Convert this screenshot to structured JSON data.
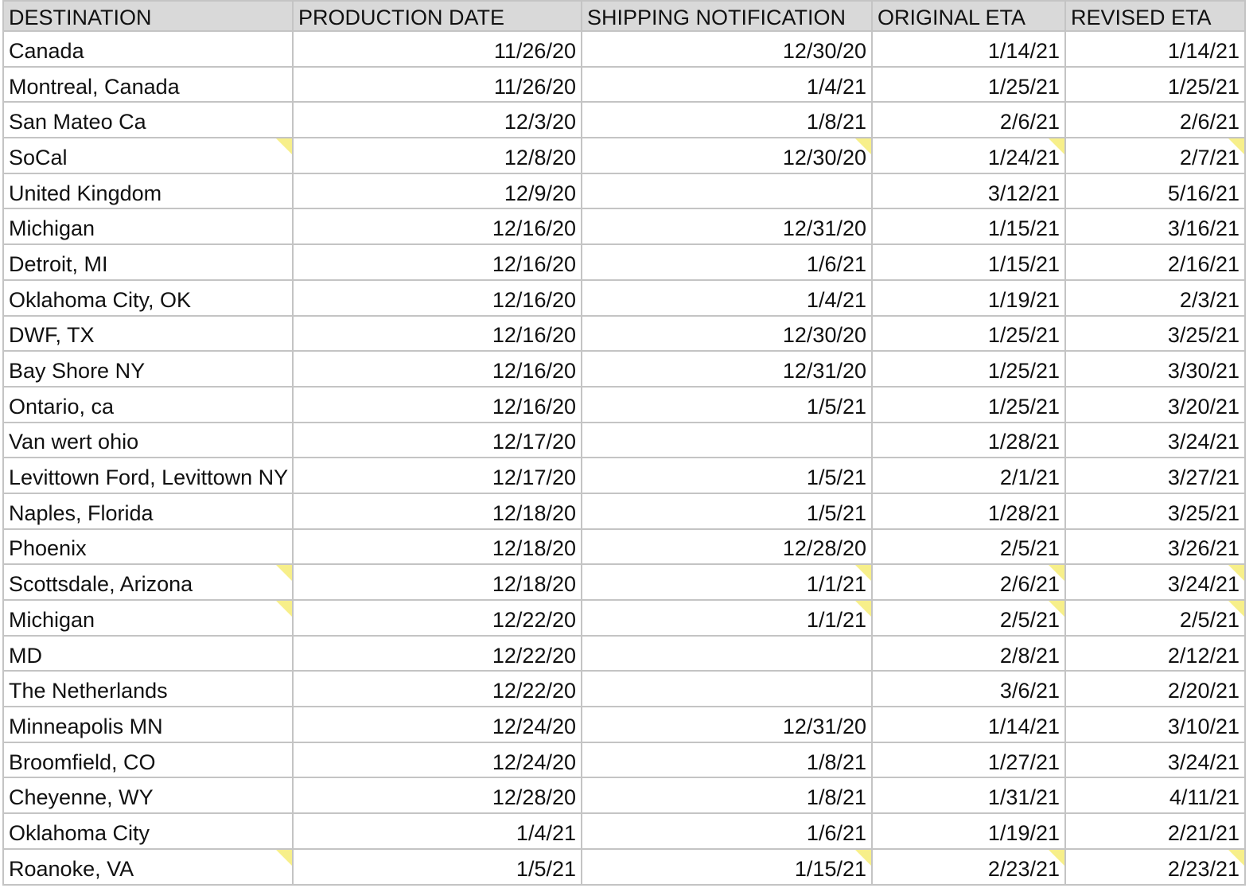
{
  "sheet": {
    "columns": [
      "DESTINATION",
      "PRODUCTION DATE",
      "SHIPPING NOTIFICATION",
      "ORIGINAL ETA",
      "REVISED ETA"
    ],
    "note_color": "#f7ef8a",
    "rows": [
      {
        "cells": [
          "Canada",
          "11/26/20",
          "12/30/20",
          "1/14/21",
          "1/14/21"
        ],
        "notes": [
          false,
          false,
          false,
          false,
          false
        ]
      },
      {
        "cells": [
          "Montreal, Canada",
          "11/26/20",
          "1/4/21",
          "1/25/21",
          "1/25/21"
        ],
        "notes": [
          false,
          false,
          false,
          false,
          false
        ]
      },
      {
        "cells": [
          "San Mateo Ca",
          "12/3/20",
          "1/8/21",
          "2/6/21",
          "2/6/21"
        ],
        "notes": [
          false,
          false,
          false,
          false,
          false
        ]
      },
      {
        "cells": [
          "SoCal",
          "12/8/20",
          "12/30/20",
          "1/24/21",
          "2/7/21"
        ],
        "notes": [
          true,
          false,
          true,
          true,
          true
        ]
      },
      {
        "cells": [
          "United Kingdom",
          "12/9/20",
          "",
          "3/12/21",
          "5/16/21"
        ],
        "notes": [
          false,
          false,
          false,
          false,
          false
        ]
      },
      {
        "cells": [
          "Michigan",
          "12/16/20",
          "12/31/20",
          "1/15/21",
          "3/16/21"
        ],
        "notes": [
          false,
          false,
          false,
          false,
          false
        ]
      },
      {
        "cells": [
          "Detroit, MI",
          "12/16/20",
          "1/6/21",
          "1/15/21",
          "2/16/21"
        ],
        "notes": [
          false,
          false,
          false,
          false,
          false
        ]
      },
      {
        "cells": [
          "Oklahoma City, OK",
          "12/16/20",
          "1/4/21",
          "1/19/21",
          "2/3/21"
        ],
        "notes": [
          false,
          false,
          false,
          false,
          false
        ]
      },
      {
        "cells": [
          "DWF, TX",
          "12/16/20",
          "12/30/20",
          "1/25/21",
          "3/25/21"
        ],
        "notes": [
          false,
          false,
          false,
          false,
          false
        ]
      },
      {
        "cells": [
          "Bay Shore NY",
          "12/16/20",
          "12/31/20",
          "1/25/21",
          "3/30/21"
        ],
        "notes": [
          false,
          false,
          false,
          false,
          false
        ]
      },
      {
        "cells": [
          "Ontario, ca",
          "12/16/20",
          "1/5/21",
          "1/25/21",
          "3/20/21"
        ],
        "notes": [
          false,
          false,
          false,
          false,
          false
        ]
      },
      {
        "cells": [
          "Van wert ohio",
          "12/17/20",
          "",
          "1/28/21",
          "3/24/21"
        ],
        "notes": [
          false,
          false,
          false,
          false,
          false
        ]
      },
      {
        "cells": [
          "Levittown Ford, Levittown NY",
          "12/17/20",
          "1/5/21",
          "2/1/21",
          "3/27/21"
        ],
        "notes": [
          false,
          false,
          false,
          false,
          false
        ]
      },
      {
        "cells": [
          "Naples, Florida",
          "12/18/20",
          "1/5/21",
          "1/28/21",
          "3/25/21"
        ],
        "notes": [
          false,
          false,
          false,
          false,
          false
        ]
      },
      {
        "cells": [
          "Phoenix",
          "12/18/20",
          "12/28/20",
          "2/5/21",
          "3/26/21"
        ],
        "notes": [
          false,
          false,
          false,
          false,
          false
        ]
      },
      {
        "cells": [
          "Scottsdale, Arizona",
          "12/18/20",
          "1/1/21",
          "2/6/21",
          "3/24/21"
        ],
        "notes": [
          true,
          false,
          true,
          true,
          true
        ]
      },
      {
        "cells": [
          "Michigan",
          "12/22/20",
          "1/1/21",
          "2/5/21",
          "2/5/21"
        ],
        "notes": [
          true,
          false,
          true,
          true,
          true
        ]
      },
      {
        "cells": [
          "MD",
          "12/22/20",
          "",
          "2/8/21",
          "2/12/21"
        ],
        "notes": [
          false,
          false,
          false,
          false,
          false
        ]
      },
      {
        "cells": [
          "The Netherlands",
          "12/22/20",
          "",
          "3/6/21",
          "2/20/21"
        ],
        "notes": [
          false,
          false,
          false,
          false,
          false
        ]
      },
      {
        "cells": [
          "Minneapolis MN",
          "12/24/20",
          "12/31/20",
          "1/14/21",
          "3/10/21"
        ],
        "notes": [
          false,
          false,
          false,
          false,
          false
        ]
      },
      {
        "cells": [
          "Broomfield, CO",
          "12/24/20",
          "1/8/21",
          "1/27/21",
          "3/24/21"
        ],
        "notes": [
          false,
          false,
          false,
          false,
          false
        ]
      },
      {
        "cells": [
          "Cheyenne, WY",
          "12/28/20",
          "1/8/21",
          "1/31/21",
          "4/11/21"
        ],
        "notes": [
          false,
          false,
          false,
          false,
          false
        ]
      },
      {
        "cells": [
          "Oklahoma City",
          "1/4/21",
          "1/6/21",
          "1/19/21",
          "2/21/21"
        ],
        "notes": [
          false,
          false,
          false,
          false,
          false
        ]
      },
      {
        "cells": [
          "Roanoke, VA",
          "1/5/21",
          "1/15/21",
          "2/23/21",
          "2/23/21"
        ],
        "notes": [
          true,
          false,
          true,
          true,
          true
        ]
      }
    ]
  }
}
